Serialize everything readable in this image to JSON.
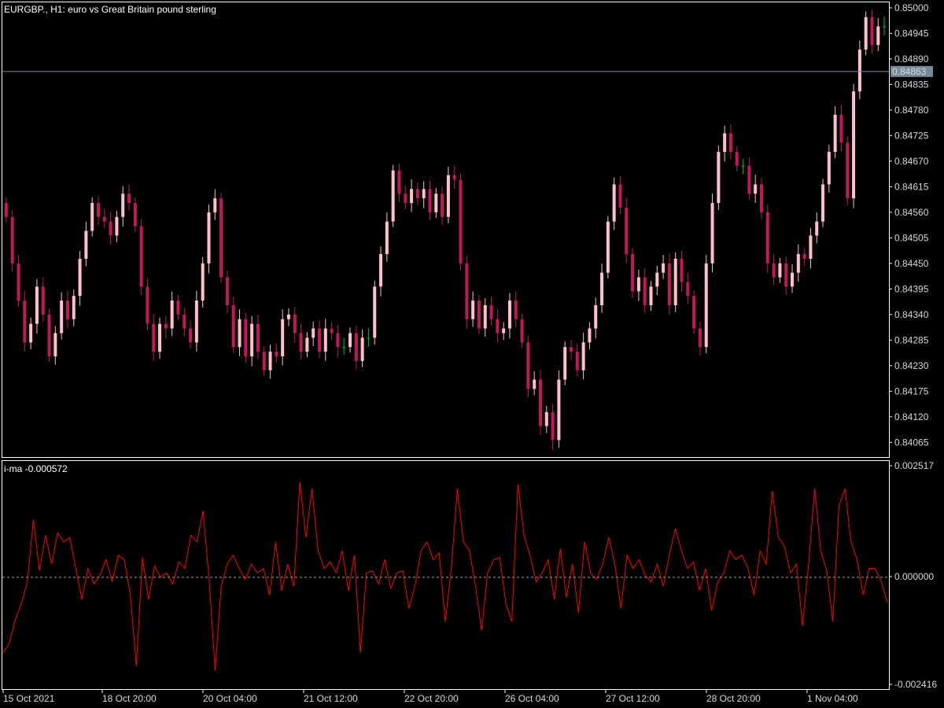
{
  "window": {
    "symbol_label": "EURGBP., H1:  euro vs Great Britain pound sterling",
    "current_price_label": "0.84863"
  },
  "indicator": {
    "label": "i-ma -0.000572",
    "zero_label": "0.000000",
    "max_label": "0.002517",
    "min_label": "-0.002416"
  },
  "price_axis": {
    "ticks": [
      "0.85000",
      "0.84945",
      "0.84890",
      "0.84835",
      "0.84780",
      "0.84725",
      "0.84670",
      "0.84615",
      "0.84560",
      "0.84505",
      "0.84450",
      "0.84395",
      "0.84340",
      "0.84285",
      "0.84230",
      "0.84175",
      "0.84120",
      "0.84065"
    ]
  },
  "time_axis": {
    "ticks": [
      "15 Oct 2021",
      "18 Oct 20:00",
      "20 Oct 04:00",
      "21 Oct 12:00",
      "22 Oct 20:00",
      "26 Oct 04:00",
      "27 Oct 12:00",
      "28 Oct 20:00",
      "1 Nov 04:00"
    ]
  },
  "colors": {
    "background": "#000000",
    "grid_border": "#ffffff",
    "bull_candle": "#ffc0cb",
    "bear_candle": "#c2185b",
    "doji_candle": "#00c000",
    "indicator_line": "#ff0000",
    "zero_line": "#a0a0a0",
    "price_line": "#778899",
    "price_badge": "#778899"
  },
  "chart_data": [
    {
      "type": "candlestick",
      "title": "EURGBP., H1:  euro vs Great Britain pound sterling",
      "ylim": [
        0.84035,
        0.8501
      ],
      "current_price": 0.84863,
      "close": [
        0.8455,
        0.8445,
        0.8437,
        0.8428,
        0.8432,
        0.844,
        0.8434,
        0.8425,
        0.843,
        0.8437,
        0.8433,
        0.8438,
        0.8446,
        0.8452,
        0.8458,
        0.8455,
        0.8454,
        0.8451,
        0.8455,
        0.846,
        0.8458,
        0.8453,
        0.844,
        0.8432,
        0.8426,
        0.8432,
        0.8431,
        0.8437,
        0.8434,
        0.8431,
        0.8428,
        0.8437,
        0.8445,
        0.8456,
        0.8459,
        0.8442,
        0.8436,
        0.8427,
        0.8433,
        0.8425,
        0.8432,
        0.8426,
        0.8422,
        0.8426,
        0.8425,
        0.8433,
        0.8434,
        0.843,
        0.8426,
        0.8429,
        0.8431,
        0.8426,
        0.8431,
        0.843,
        0.8427,
        0.8427,
        0.843,
        0.8424,
        0.8429,
        0.8429,
        0.844,
        0.8447,
        0.8454,
        0.8465,
        0.846,
        0.8458,
        0.8461,
        0.8459,
        0.8461,
        0.8456,
        0.846,
        0.8455,
        0.8464,
        0.8463,
        0.8445,
        0.8433,
        0.8437,
        0.8431,
        0.8436,
        0.8433,
        0.843,
        0.8431,
        0.8437,
        0.8433,
        0.8428,
        0.8418,
        0.842,
        0.841,
        0.8413,
        0.8407,
        0.842,
        0.8427,
        0.8426,
        0.8422,
        0.8428,
        0.8431,
        0.8436,
        0.8443,
        0.8454,
        0.8462,
        0.8457,
        0.8447,
        0.8439,
        0.8442,
        0.8436,
        0.844,
        0.8443,
        0.8445,
        0.8436,
        0.8446,
        0.8441,
        0.8438,
        0.8431,
        0.8427,
        0.8445,
        0.8458,
        0.8469,
        0.8473,
        0.8469,
        0.8466,
        0.8466,
        0.846,
        0.8462,
        0.8456,
        0.8445,
        0.8442,
        0.8445,
        0.844,
        0.8443,
        0.8447,
        0.8446,
        0.8451,
        0.8454,
        0.8462,
        0.8469,
        0.8477,
        0.8471,
        0.8459,
        0.8482,
        0.8491,
        0.8498,
        0.8492,
        0.8496,
        0.8496
      ]
    },
    {
      "type": "line",
      "title": "i-ma -0.000572",
      "ylim": [
        -0.002416,
        0.002517
      ],
      "zero_line": 0.0,
      "series": [
        {
          "values": [
            -0.0017,
            -0.0015,
            -0.00095,
            -0.0006,
            -0.0001,
            0.0013,
            0.00015,
            0.00095,
            0.0003,
            0.001,
            0.0008,
            0.0009,
            0.0002,
            -0.0005,
            0.0002,
            -0.00015,
            5e-05,
            0.0004,
            -0.0001,
            0.0005,
            0.0004,
            -0.0004,
            -0.002,
            0.00045,
            -0.0005,
            0.00025,
            0.0,
            0.0001,
            -0.00015,
            0.00035,
            0.0002,
            0.00095,
            0.0008,
            0.0015,
            -5e-05,
            -0.0021,
            -0.0002,
            0.0003,
            0.0005,
            0.0002,
            -5e-05,
            0.0003,
            0.0001,
            0.0002,
            -0.0004,
            0.0008,
            -0.0003,
            0.0003,
            -0.0002,
            0.00215,
            0.0009,
            0.002,
            0.0006,
            0.0002,
            0.00035,
            0.0001,
            0.0006,
            -0.0003,
            0.0005,
            -0.0017,
            0.0001,
            0.00015,
            -0.00015,
            0.0004,
            -0.00025,
            0.0001,
            0.00015,
            -0.0007,
            -0.0002,
            0.0006,
            0.0008,
            0.0004,
            0.00055,
            -0.001,
            0.0002,
            0.002,
            0.0008,
            0.0006,
            -0.0002,
            -0.0012,
            0.0001,
            0.0004,
            0.00045,
            -0.0006,
            -0.001,
            0.0021,
            0.00095,
            0.0005,
            -0.0001,
            0.0001,
            0.0004,
            -0.0005,
            0.00065,
            -0.00045,
            0.0003,
            -0.0008,
            0.0008,
            0.0001,
            -5e-05,
            0.0003,
            0.0009,
            0.0003,
            -0.0007,
            0.0005,
            0.0002,
            0.0004,
            5e-05,
            -0.0001,
            0.0003,
            -0.0002,
            0.0005,
            0.0011,
            0.0006,
            0.0002,
            0.00035,
            -0.0003,
            0.0002,
            -0.00075,
            -0.0001,
            0.0001,
            0.0006,
            0.0004,
            0.0005,
            0.0002,
            -0.0004,
            0.0006,
            0.0003,
            0.00195,
            0.0009,
            0.0007,
            0.0001,
            0.0003,
            -0.0011,
            0.0003,
            0.002,
            0.0006,
            0.00015,
            -0.001,
            0.0016,
            0.002,
            0.0008,
            0.0004,
            -0.0004,
            0.0002,
            0.0002,
            -0.0001,
            -0.00057
          ]
        }
      ]
    }
  ]
}
